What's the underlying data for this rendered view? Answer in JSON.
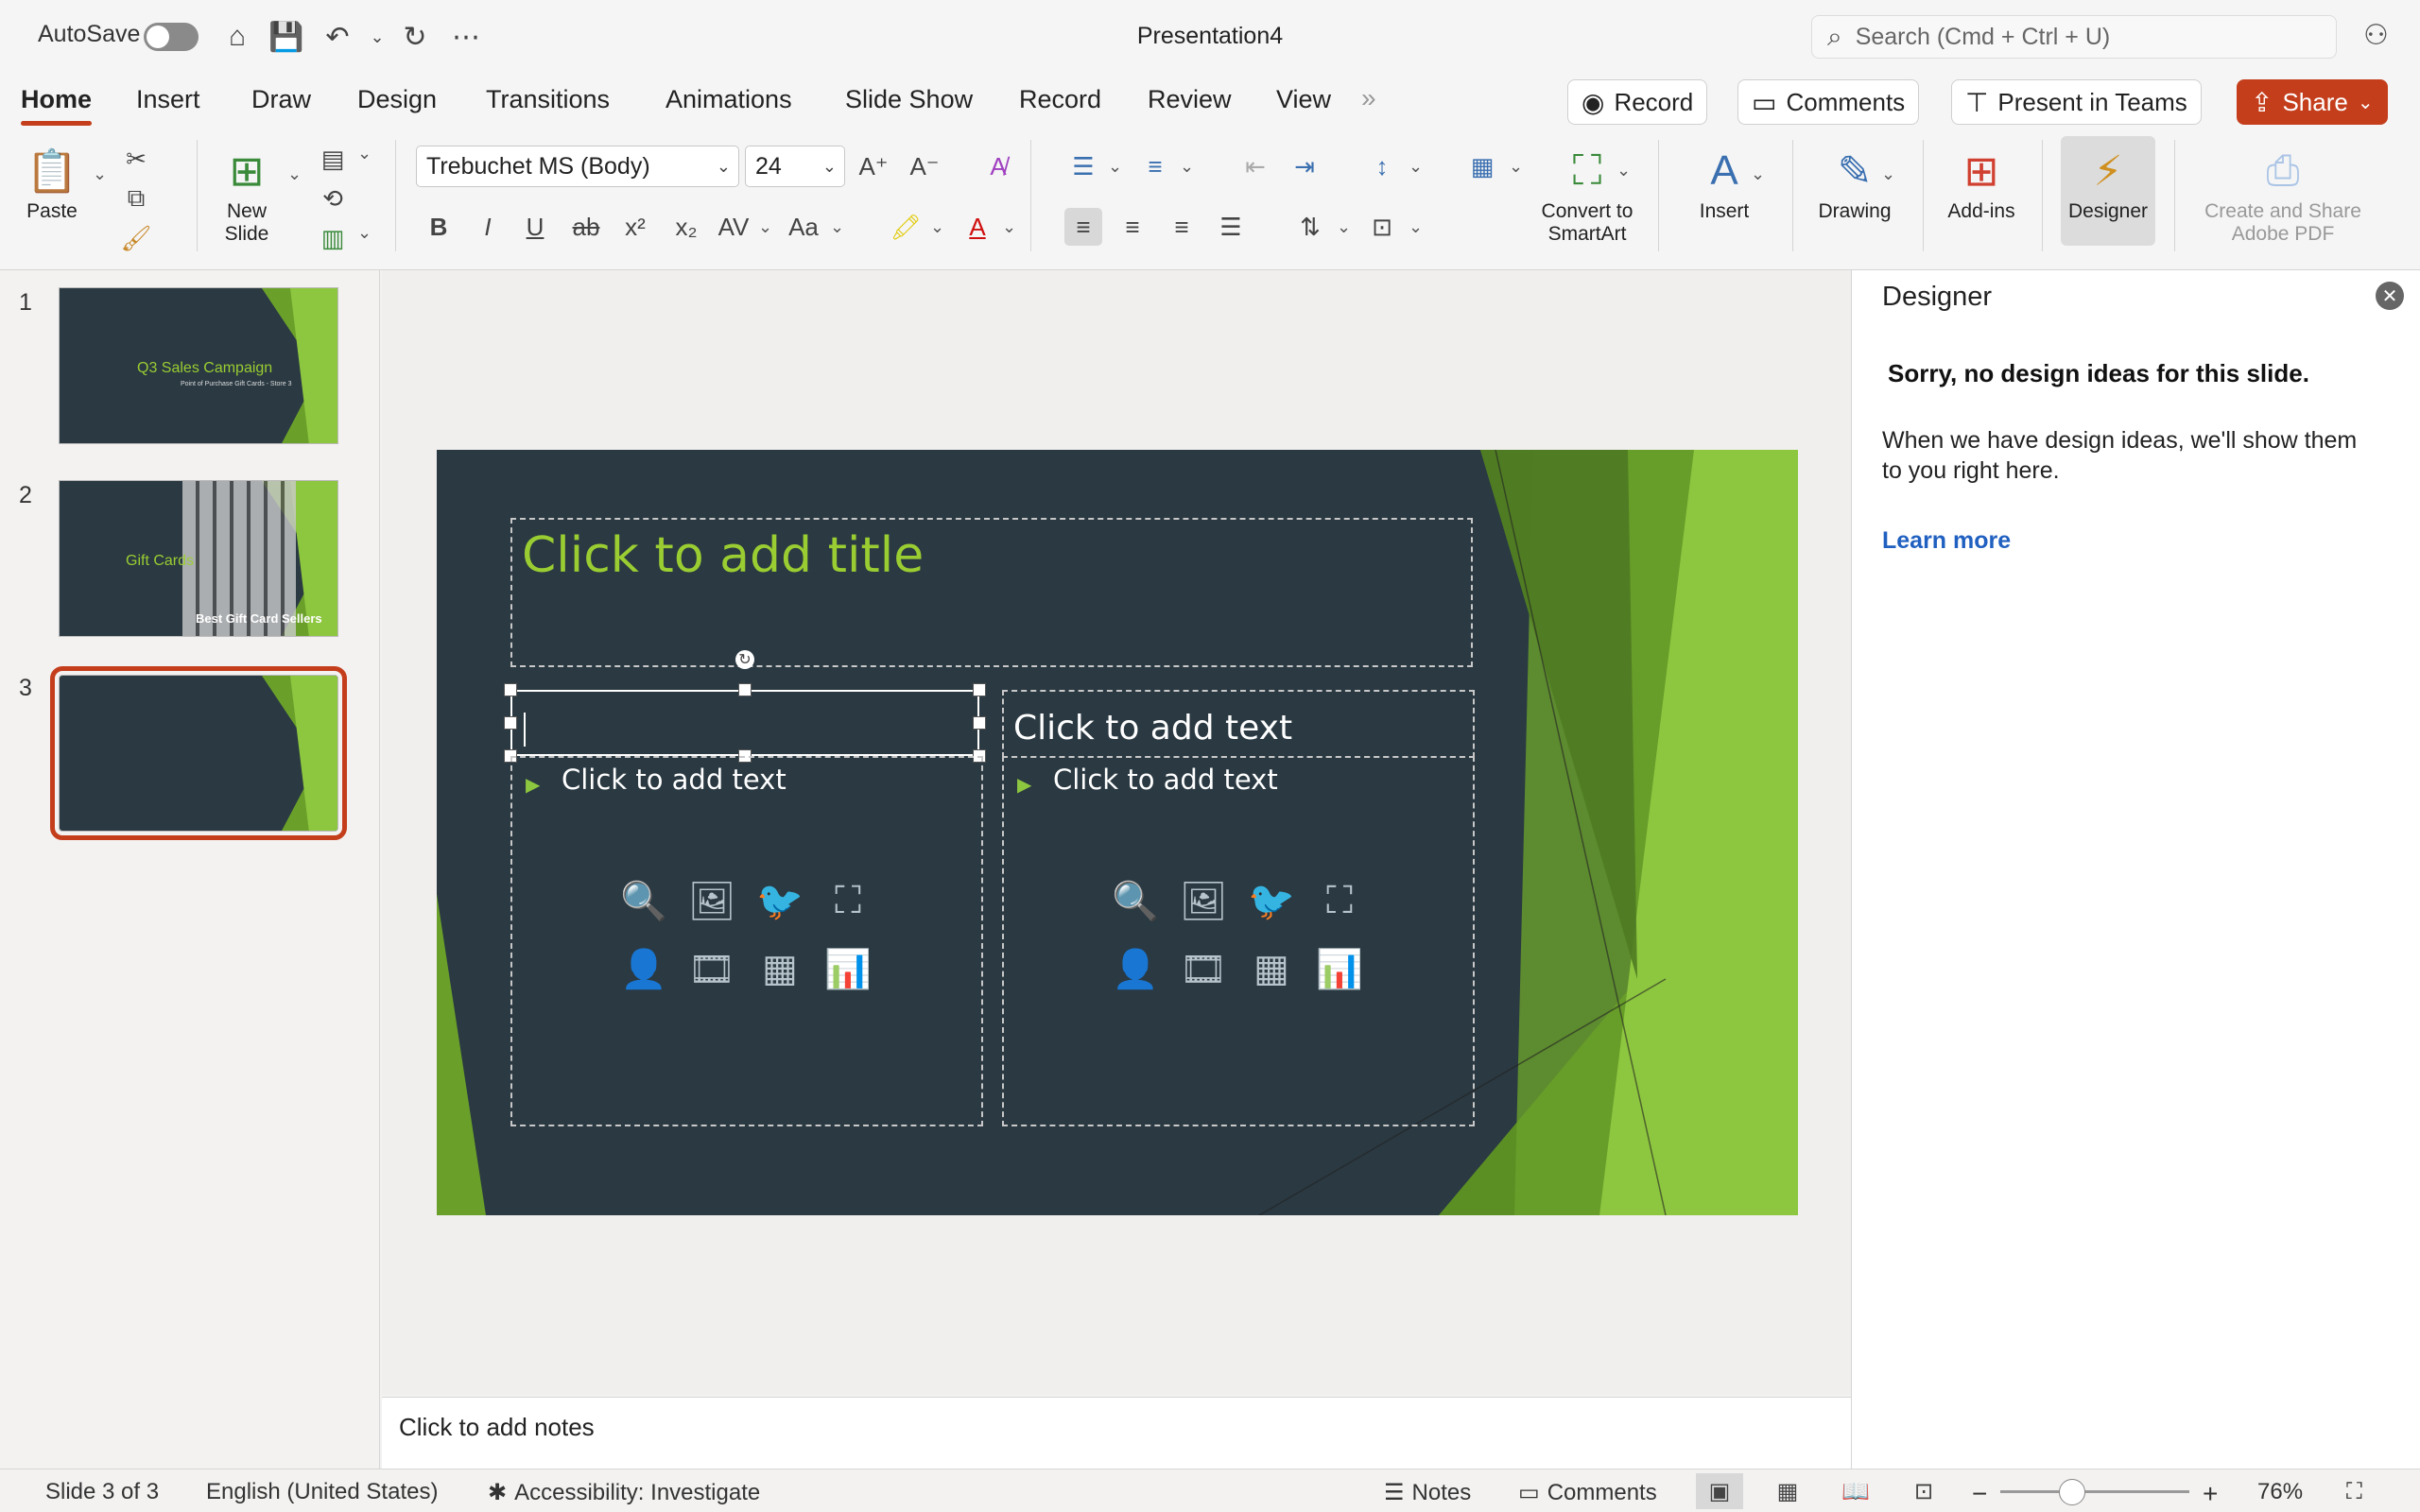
{
  "titlebar": {
    "autosave": "AutoSave",
    "doc_title": "Presentation4",
    "search_placeholder": "Search (Cmd + Ctrl + U)"
  },
  "tabs": [
    "Home",
    "Insert",
    "Draw",
    "Design",
    "Transitions",
    "Animations",
    "Slide Show",
    "Record",
    "Review",
    "View"
  ],
  "tab_more": "»",
  "actions": {
    "record": "Record",
    "comments": "Comments",
    "present": "Present in Teams",
    "share": "Share"
  },
  "ribbon": {
    "paste": "Paste",
    "new_slide_1": "New",
    "new_slide_2": "Slide",
    "font_name": "Trebuchet MS (Body)",
    "font_size": "24",
    "convert_1": "Convert to",
    "convert_2": "SmartArt",
    "insert": "Insert",
    "drawing": "Drawing",
    "addins": "Add-ins",
    "designer": "Designer",
    "adobe_1": "Create and Share",
    "adobe_2": "Adobe PDF"
  },
  "thumbnails": [
    {
      "num": "1",
      "title": "Q3 Sales Campaign",
      "subtitle": "Point of Purchase Gift Cards - Store 3"
    },
    {
      "num": "2",
      "title": "Gift Cards",
      "subtitle": "Best Gift Card Sellers"
    },
    {
      "num": "3",
      "title": "",
      "subtitle": ""
    }
  ],
  "slide": {
    "title_placeholder": "Click to add title",
    "right_header": "Click to add text",
    "left_body": "Click to add text",
    "right_body": "Click to add text",
    "colors": {
      "background": "#2a3942",
      "accent": "#9acd32"
    }
  },
  "notes": "Click to add notes",
  "designer": {
    "header": "Designer",
    "sorry": "Sorry, no design ideas for this slide.",
    "body": "When we have design ideas, we'll show them to you right here.",
    "learn_more": "Learn more"
  },
  "status": {
    "slide": "Slide 3 of 3",
    "language": "English (United States)",
    "accessibility": "Accessibility: Investigate",
    "notes": "Notes",
    "comments": "Comments",
    "zoom": "76%"
  }
}
